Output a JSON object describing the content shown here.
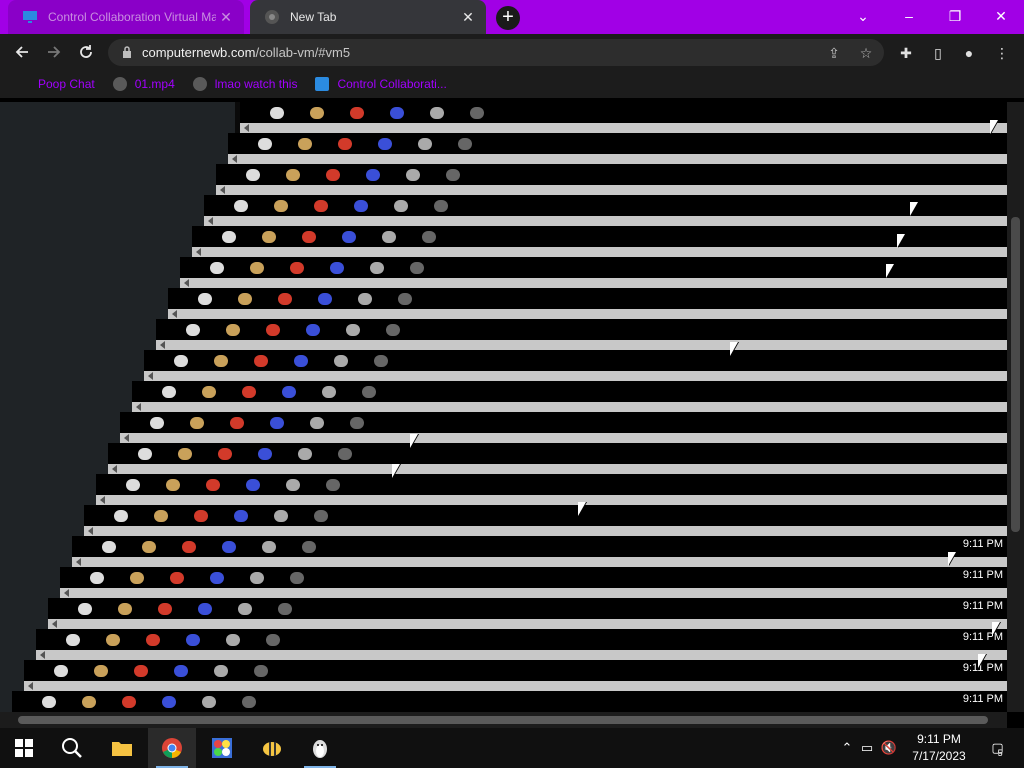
{
  "browser": {
    "tabs": [
      {
        "title": "Control Collaboration Virtual Ma...",
        "active": true
      },
      {
        "title": "New Tab",
        "active": false
      }
    ],
    "new_tab_label": "+",
    "window_controls": {
      "minimize": "–",
      "restore": "❐",
      "close": "✕",
      "tab_search": "⌄"
    },
    "url_host": "computernewb.com",
    "url_path": "/collab-vm/#vm5",
    "bookmarks": [
      {
        "label": "Poop Chat",
        "icon": "none"
      },
      {
        "label": "01.mp4",
        "icon": "globe-icon"
      },
      {
        "label": "lmao watch this",
        "icon": "globe-icon"
      },
      {
        "label": "Control Collaborati...",
        "icon": "monitor-icon"
      }
    ]
  },
  "vm_screen": {
    "clock_text": "9:11 PM"
  },
  "taskbar": {
    "clock_time": "9:11 PM",
    "clock_date": "7/17/2023",
    "notification_count": "5"
  },
  "colors": {
    "tab_strip": "#a100e6",
    "bookmark_text": "#a200ff",
    "page_bg": "#1f2326"
  }
}
